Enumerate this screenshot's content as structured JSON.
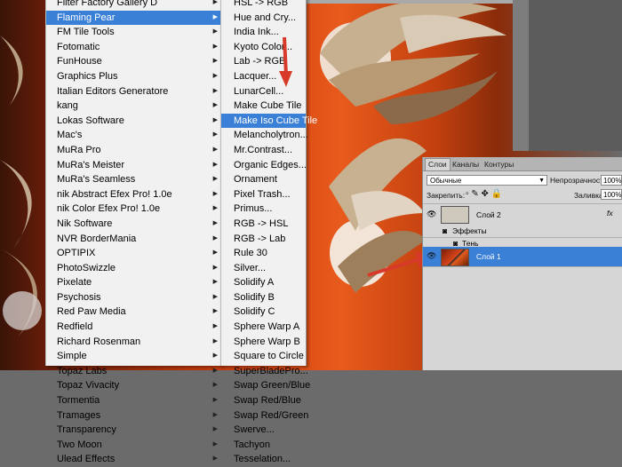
{
  "menu1": {
    "items": [
      {
        "label": "Filter Factory Gallery D",
        "sub": true
      },
      {
        "label": "Flaming Pear",
        "sub": true,
        "selected": true
      },
      {
        "label": "FM Tile Tools",
        "sub": true
      },
      {
        "label": "Fotomatic",
        "sub": true
      },
      {
        "label": "FunHouse",
        "sub": true
      },
      {
        "label": "Graphics Plus",
        "sub": true
      },
      {
        "label": "Italian Editors Generatore",
        "sub": true
      },
      {
        "label": "kang",
        "sub": true
      },
      {
        "label": "Lokas Software",
        "sub": true
      },
      {
        "label": "Mac's",
        "sub": true
      },
      {
        "label": "MuRa Pro",
        "sub": true
      },
      {
        "label": "MuRa's Meister",
        "sub": true
      },
      {
        "label": "MuRa's Seamless",
        "sub": true
      },
      {
        "label": "nik Abstract Efex Pro! 1.0e",
        "sub": true
      },
      {
        "label": "nik Color Efex Pro! 1.0e",
        "sub": true
      },
      {
        "label": "Nik Software",
        "sub": true
      },
      {
        "label": "NVR BorderMania",
        "sub": true
      },
      {
        "label": "OPTIPIX",
        "sub": true
      },
      {
        "label": "PhotoSwizzle",
        "sub": true
      },
      {
        "label": "Pixelate",
        "sub": true
      },
      {
        "label": "Psychosis",
        "sub": true
      },
      {
        "label": "Red Paw Media",
        "sub": true
      },
      {
        "label": "Redfield",
        "sub": true
      },
      {
        "label": "Richard Rosenman",
        "sub": true
      },
      {
        "label": "Simple",
        "sub": true
      },
      {
        "label": "Topaz Labs",
        "sub": true
      },
      {
        "label": "Topaz Vivacity",
        "sub": true
      },
      {
        "label": "Tormentia",
        "sub": true
      },
      {
        "label": "Tramages",
        "sub": true
      },
      {
        "label": "Transparency",
        "sub": true
      },
      {
        "label": "Two Moon",
        "sub": true
      },
      {
        "label": "Ulead Effects",
        "sub": true
      }
    ]
  },
  "menu2": {
    "items": [
      {
        "label": "HSL -> RGB"
      },
      {
        "label": "Hue and Cry..."
      },
      {
        "label": "India Ink..."
      },
      {
        "label": "Kyoto Color..."
      },
      {
        "label": "Lab -> RGB"
      },
      {
        "label": "Lacquer..."
      },
      {
        "label": "LunarCell..."
      },
      {
        "label": "Make Cube Tile"
      },
      {
        "label": "Make Iso Cube Tile",
        "selected": true
      },
      {
        "label": "Melancholytron..."
      },
      {
        "label": "Mr.Contrast..."
      },
      {
        "label": "Organic Edges..."
      },
      {
        "label": "Ornament"
      },
      {
        "label": "Pixel Trash..."
      },
      {
        "label": "Primus..."
      },
      {
        "label": "RGB -> HSL"
      },
      {
        "label": "RGB -> Lab"
      },
      {
        "label": "Rule 30"
      },
      {
        "label": "Silver..."
      },
      {
        "label": "Solidify A"
      },
      {
        "label": "Solidify B"
      },
      {
        "label": "Solidify C"
      },
      {
        "label": "Sphere Warp A"
      },
      {
        "label": "Sphere Warp B"
      },
      {
        "label": "Square to Circle"
      },
      {
        "label": "SuperBladePro..."
      },
      {
        "label": "Swap Green/Blue"
      },
      {
        "label": "Swap Red/Blue"
      },
      {
        "label": "Swap Red/Green"
      },
      {
        "label": "Swerve..."
      },
      {
        "label": "Tachyon"
      },
      {
        "label": "Tesselation..."
      }
    ]
  },
  "layers": {
    "tabs": [
      "Слои",
      "Каналы",
      "Контуры"
    ],
    "blend_mode": "Обычные",
    "opacity_label": "Непрозрачность:",
    "opacity_value": "100%",
    "lock_label": "Закрепить:",
    "fill_label": "Заливка:",
    "fill_value": "100%",
    "layer2_name": "Слой 2",
    "fx": "fx",
    "effects_label": "Эффекты",
    "shadow_label": "Тень",
    "layer1_name": "Слой 1"
  },
  "colors": {
    "menu_highlight": "#3b80d7",
    "arrow_red": "#d83a2a"
  }
}
